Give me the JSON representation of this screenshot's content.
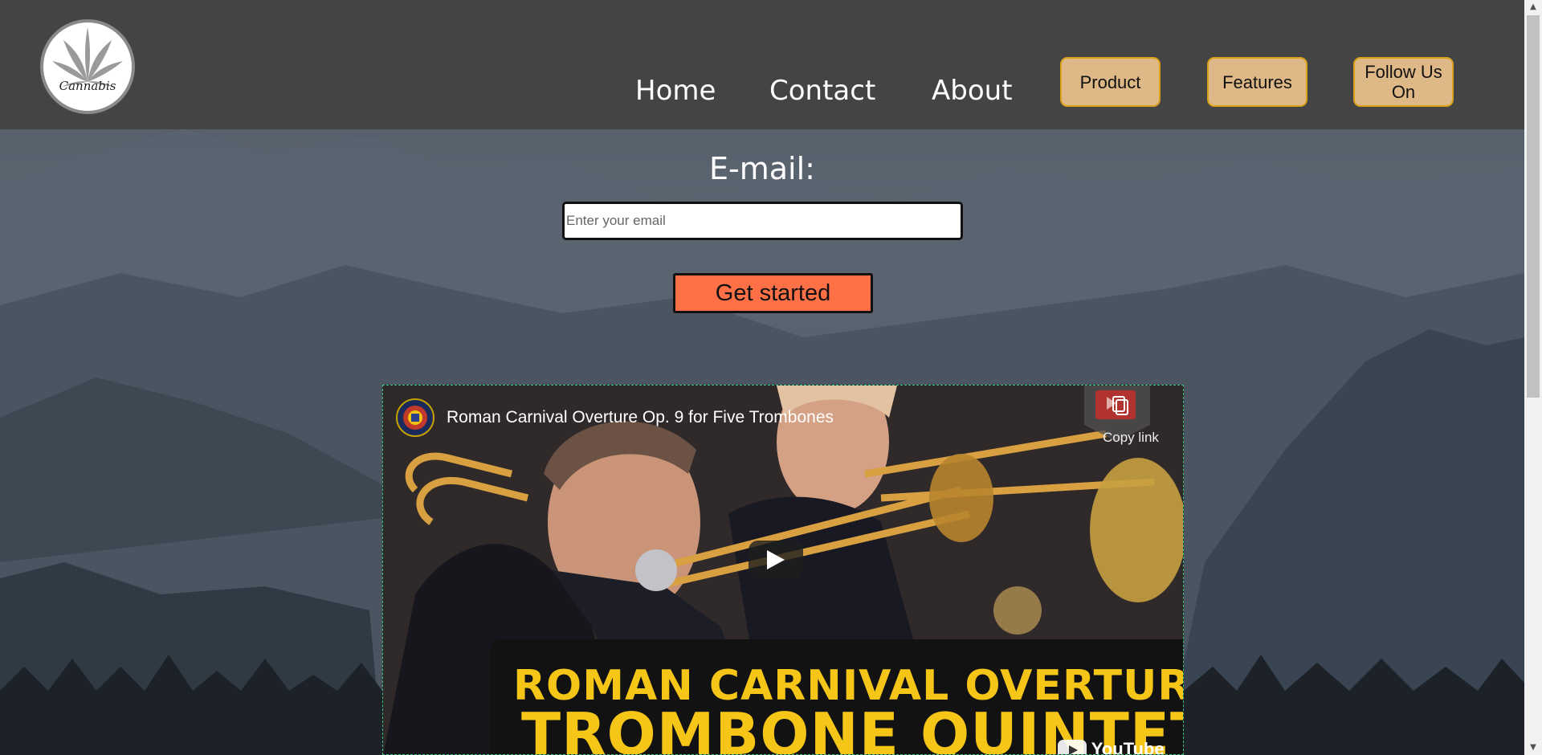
{
  "header": {
    "logo_text": "Cannabis",
    "nav_links": [
      "Home",
      "Contact",
      "About"
    ],
    "nav_buttons": [
      "Product",
      "Features",
      "Follow Us On"
    ]
  },
  "form": {
    "label": "E-mail:",
    "placeholder": "Enter your email",
    "cta": "Get started"
  },
  "video": {
    "title": "Roman Carnival Overture Op. 9 for Five Trombones",
    "copy_link": "Copy link",
    "banner_line1": "ROMAN CARNIVAL OVERTURE",
    "banner_line2": "TROMBONE QUINTET",
    "platform": "YouTube"
  },
  "colors": {
    "header_bg": "#444444",
    "nav_button_bg": "#deb887",
    "cta_bg": "#ff7047",
    "banner_text": "#f5c518"
  },
  "icons": [
    "cannabis-leaf-icon",
    "copy-link-icon",
    "play-icon",
    "youtube-icon",
    "scroll-up-icon",
    "scroll-down-icon"
  ]
}
